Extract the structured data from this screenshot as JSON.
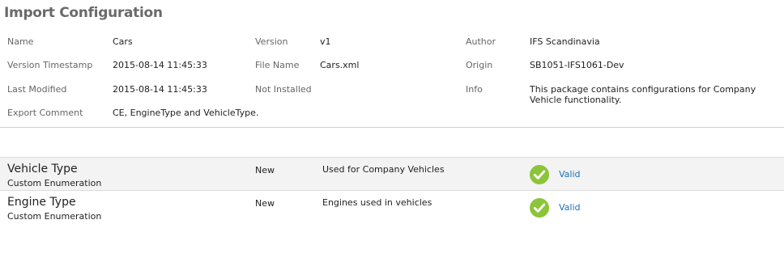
{
  "title": "Import Configuration",
  "meta": {
    "name_label": "Name",
    "name_value": "Cars",
    "version_label": "Version",
    "version_value": "v1",
    "author_label": "Author",
    "author_value": "IFS Scandinavia",
    "version_timestamp_label": "Version Timestamp",
    "version_timestamp_value": "2015-08-14 11:45:33",
    "file_name_label": "File Name",
    "file_name_value": "Cars.xml",
    "origin_label": "Origin",
    "origin_value": "SB1051-IFS1061-Dev",
    "last_modified_label": "Last Modified",
    "last_modified_value": "2015-08-14 11:45:33",
    "not_installed_label": "Not Installed",
    "info_label": "Info",
    "info_value": "This package contains configurations for Company Vehicle functionality.",
    "export_comment_label": "Export Comment",
    "export_comment_value": "CE, EngineType and VehicleType."
  },
  "items": [
    {
      "name": "Vehicle Type",
      "type": "Custom Enumeration",
      "state": "New",
      "description": "Used for Company Vehicles",
      "status": "Valid",
      "status_icon": "check-circle-icon"
    },
    {
      "name": "Engine Type",
      "type": "Custom Enumeration",
      "state": "New",
      "description": "Engines used in vehicles",
      "status": "Valid",
      "status_icon": "check-circle-icon"
    }
  ],
  "colors": {
    "valid_green": "#8cc43a",
    "link_blue": "#1f6fb5",
    "title_gray": "#6a6a6a"
  }
}
